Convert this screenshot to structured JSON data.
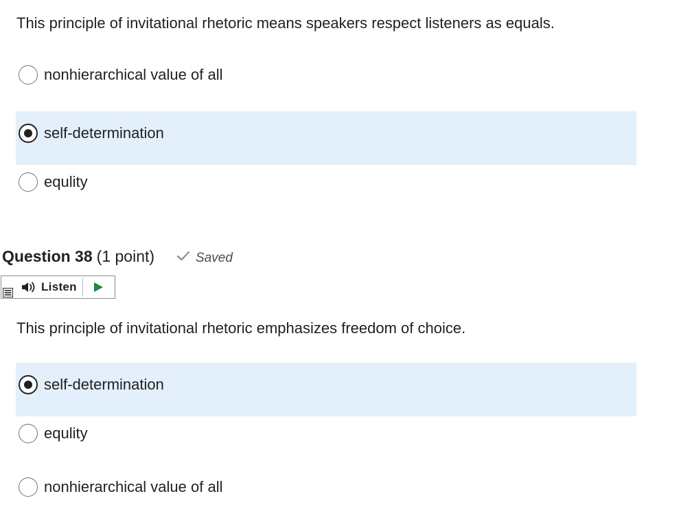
{
  "question_prev": {
    "prompt": "This principle of invitational rhetoric means speakers respect listeners as equals.",
    "options": [
      {
        "label": "nonhierarchical value of all",
        "selected": false
      },
      {
        "label": "self-determination",
        "selected": true
      },
      {
        "label": "equlity",
        "selected": false
      }
    ]
  },
  "question_38": {
    "number": "Question 38",
    "points": "(1 point)",
    "status_icon": "check-icon",
    "status": "Saved",
    "listen_label": "Listen",
    "prompt": "This principle of invitational rhetoric emphasizes freedom of choice.",
    "options": [
      {
        "label": "self-determination",
        "selected": true
      },
      {
        "label": "equlity",
        "selected": false
      },
      {
        "label": "nonhierarchical value of all",
        "selected": false
      }
    ]
  },
  "colors": {
    "selected_background": "#e3effb",
    "play_green": "#1e8a3c",
    "check_gray": "#8a8c8e"
  }
}
